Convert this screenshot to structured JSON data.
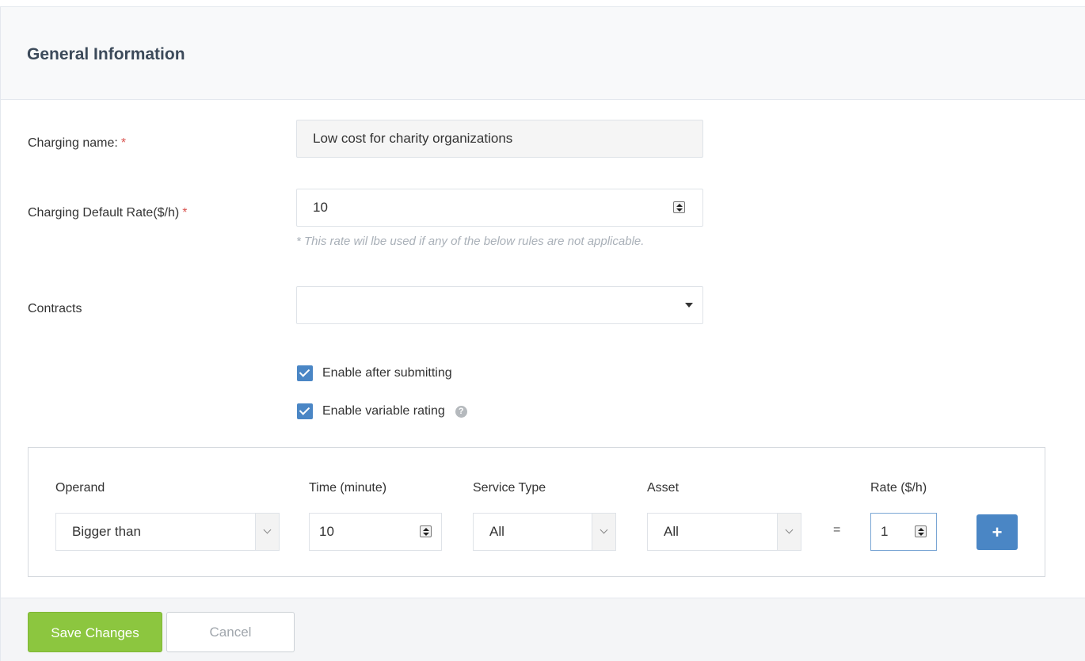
{
  "panel": {
    "title": "General Information"
  },
  "form": {
    "charging_name": {
      "label": "Charging name:",
      "required_mark": "*",
      "value": "Low cost for charity organizations"
    },
    "default_rate": {
      "label": "Charging Default Rate($/h)",
      "required_mark": "*",
      "value": "10",
      "hint": "* This rate wil lbe used if any of the below rules are not applicable."
    },
    "contracts": {
      "label": "Contracts",
      "value": ""
    },
    "enable_after_submitting": {
      "label": "Enable after submitting",
      "checked": true
    },
    "enable_variable_rating": {
      "label": "Enable variable rating",
      "checked": true,
      "help_icon": "question-circle-icon"
    }
  },
  "rules": {
    "headers": {
      "operand": "Operand",
      "time": "Time (minute)",
      "service_type": "Service Type",
      "asset": "Asset",
      "rate": "Rate ($/h)"
    },
    "row": {
      "operand": "Bigger than",
      "time": "10",
      "service_type": "All",
      "asset": "All",
      "equals": "=",
      "rate": "1",
      "add_label": "+"
    }
  },
  "footer": {
    "save_label": "Save Changes",
    "cancel_label": "Cancel"
  },
  "colors": {
    "primary": "#4a86c5",
    "save": "#8cc63f",
    "required": "#d9534f"
  }
}
